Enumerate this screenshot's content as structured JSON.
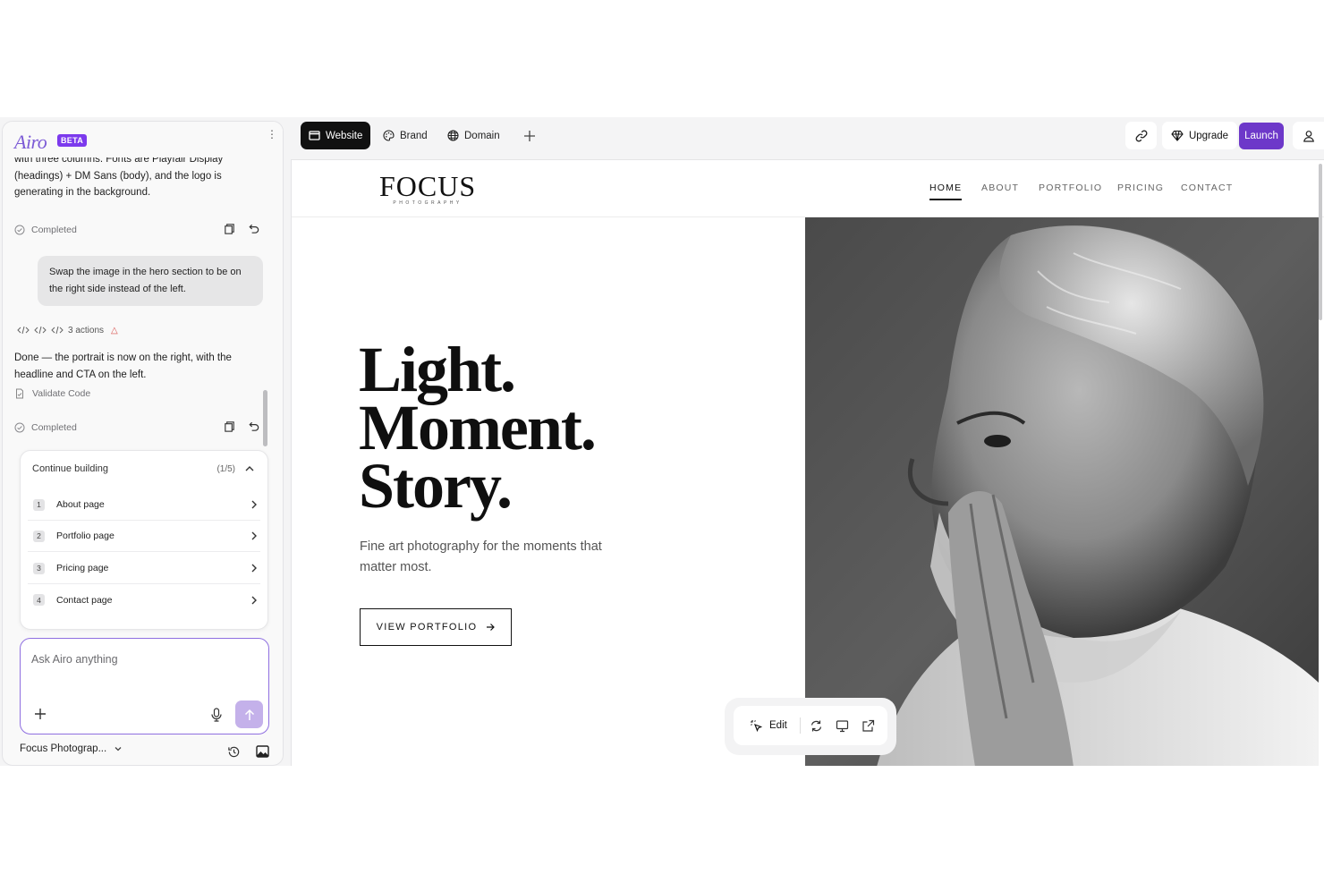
{
  "chat": {
    "logo": "Airo",
    "beta": "BETA",
    "assistant_msg_1": "with three columns. Fonts are Playfair Display (headings) + DM Sans (body), and the logo is generating in the background.",
    "status_1": "Completed",
    "user_msg": "Swap the image in the hero section to be on the right side instead of the left.",
    "actions_label": "3 actions",
    "assistant_msg_2": "Done — the portrait is now on the right, with the headline and CTA on the left.",
    "validate_label": "Validate Code",
    "status_2": "Completed",
    "continue": {
      "title": "Continue building",
      "count": "(1/5)",
      "steps": [
        {
          "num": "1",
          "label": "About page"
        },
        {
          "num": "2",
          "label": "Portfolio page"
        },
        {
          "num": "3",
          "label": "Pricing page"
        },
        {
          "num": "4",
          "label": "Contact page"
        }
      ]
    },
    "composer_placeholder": "Ask Airo anything",
    "project_name": "Focus Photograp..."
  },
  "toolbar": {
    "tabs": [
      "Website",
      "Brand",
      "Domain"
    ],
    "upgrade": "Upgrade",
    "launch": "Launch"
  },
  "site": {
    "brand_name": "FOCUS",
    "brand_sub": "PHOTOGRAPHY",
    "nav": [
      "HOME",
      "ABOUT",
      "PORTFOLIO",
      "PRICING",
      "CONTACT"
    ],
    "headline": [
      "Light.",
      "Moment.",
      "Story."
    ],
    "subhead": "Fine art photography for the moments that matter most.",
    "cta": "VIEW PORTFOLIO"
  },
  "edit_bar": {
    "edit_label": "Edit"
  },
  "colors": {
    "accent": "#6d38c9",
    "logo": "#7c5bd6",
    "send_button": "#c4b1ea"
  }
}
